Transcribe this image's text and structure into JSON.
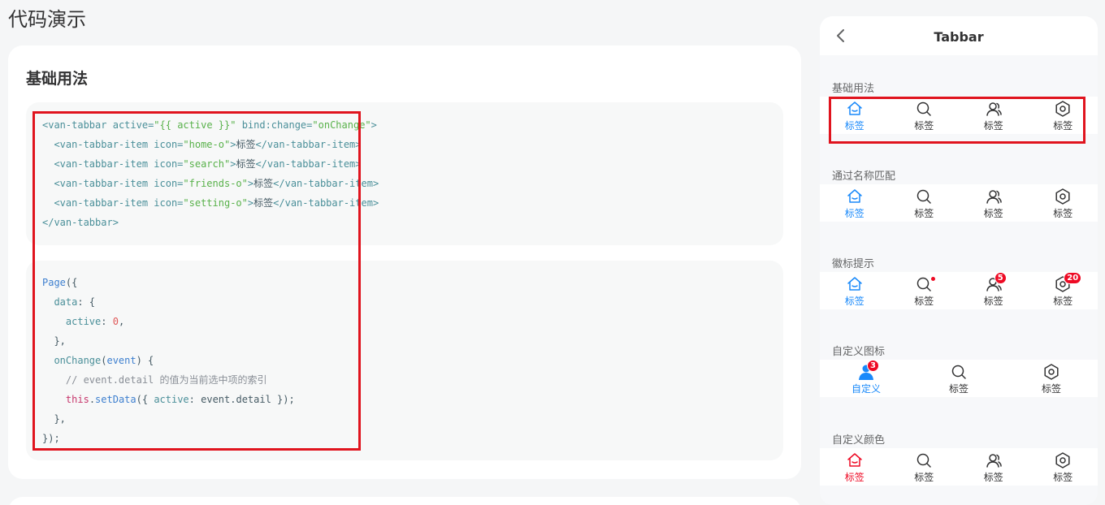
{
  "page": {
    "title": "代码演示"
  },
  "card": {
    "title": "基础用法",
    "code1": [
      "<van-tabbar active=\"{{ active }}\" bind:change=\"onChange\">",
      "  <van-tabbar-item icon=\"home-o\">标签</van-tabbar-item>",
      "  <van-tabbar-item icon=\"search\">标签</van-tabbar-item>",
      "  <van-tabbar-item icon=\"friends-o\">标签</van-tabbar-item>",
      "  <van-tabbar-item icon=\"setting-o\">标签</van-tabbar-item>",
      "</van-tabbar>"
    ],
    "code2": [
      "Page({",
      "  data: {",
      "    active: 0,",
      "  },",
      "  onChange(event) {",
      "    // event.detail 的值为当前选中项的索引",
      "    this.setData({ active: event.detail });",
      "  },",
      "});"
    ]
  },
  "phone": {
    "nav_title": "Tabbar",
    "sections": [
      {
        "title": "基础用法",
        "tabs": [
          {
            "label": "标签",
            "icon": "home-icon",
            "active": true
          },
          {
            "label": "标签",
            "icon": "search-icon"
          },
          {
            "label": "标签",
            "icon": "friends-icon"
          },
          {
            "label": "标签",
            "icon": "setting-icon"
          }
        ]
      },
      {
        "title": "通过名称匹配",
        "tabs": [
          {
            "label": "标签",
            "icon": "home-icon",
            "active": true
          },
          {
            "label": "标签",
            "icon": "search-icon"
          },
          {
            "label": "标签",
            "icon": "friends-icon"
          },
          {
            "label": "标签",
            "icon": "setting-icon"
          }
        ]
      },
      {
        "title": "徽标提示",
        "tabs": [
          {
            "label": "标签",
            "icon": "home-icon",
            "active": true
          },
          {
            "label": "标签",
            "icon": "search-icon",
            "dot": true
          },
          {
            "label": "标签",
            "icon": "friends-icon",
            "badge": "5"
          },
          {
            "label": "标签",
            "icon": "setting-icon",
            "badge": "20"
          }
        ]
      },
      {
        "title": "自定义图标",
        "tabs": [
          {
            "label": "自定义",
            "icon": "user-avatar-icon",
            "active": true,
            "badge": "3"
          },
          {
            "label": "标签",
            "icon": "search-icon"
          },
          {
            "label": "标签",
            "icon": "setting-icon"
          }
        ]
      },
      {
        "title": "自定义颜色",
        "tabs": [
          {
            "label": "标签",
            "icon": "home-icon",
            "active": true,
            "active_color": "#ee0a24"
          },
          {
            "label": "标签",
            "icon": "search-icon"
          },
          {
            "label": "标签",
            "icon": "friends-icon"
          },
          {
            "label": "标签",
            "icon": "setting-icon"
          }
        ]
      }
    ]
  },
  "colors": {
    "active": "#1989fa",
    "accent_red": "#ee0a24",
    "highlight": "#e0141e"
  }
}
